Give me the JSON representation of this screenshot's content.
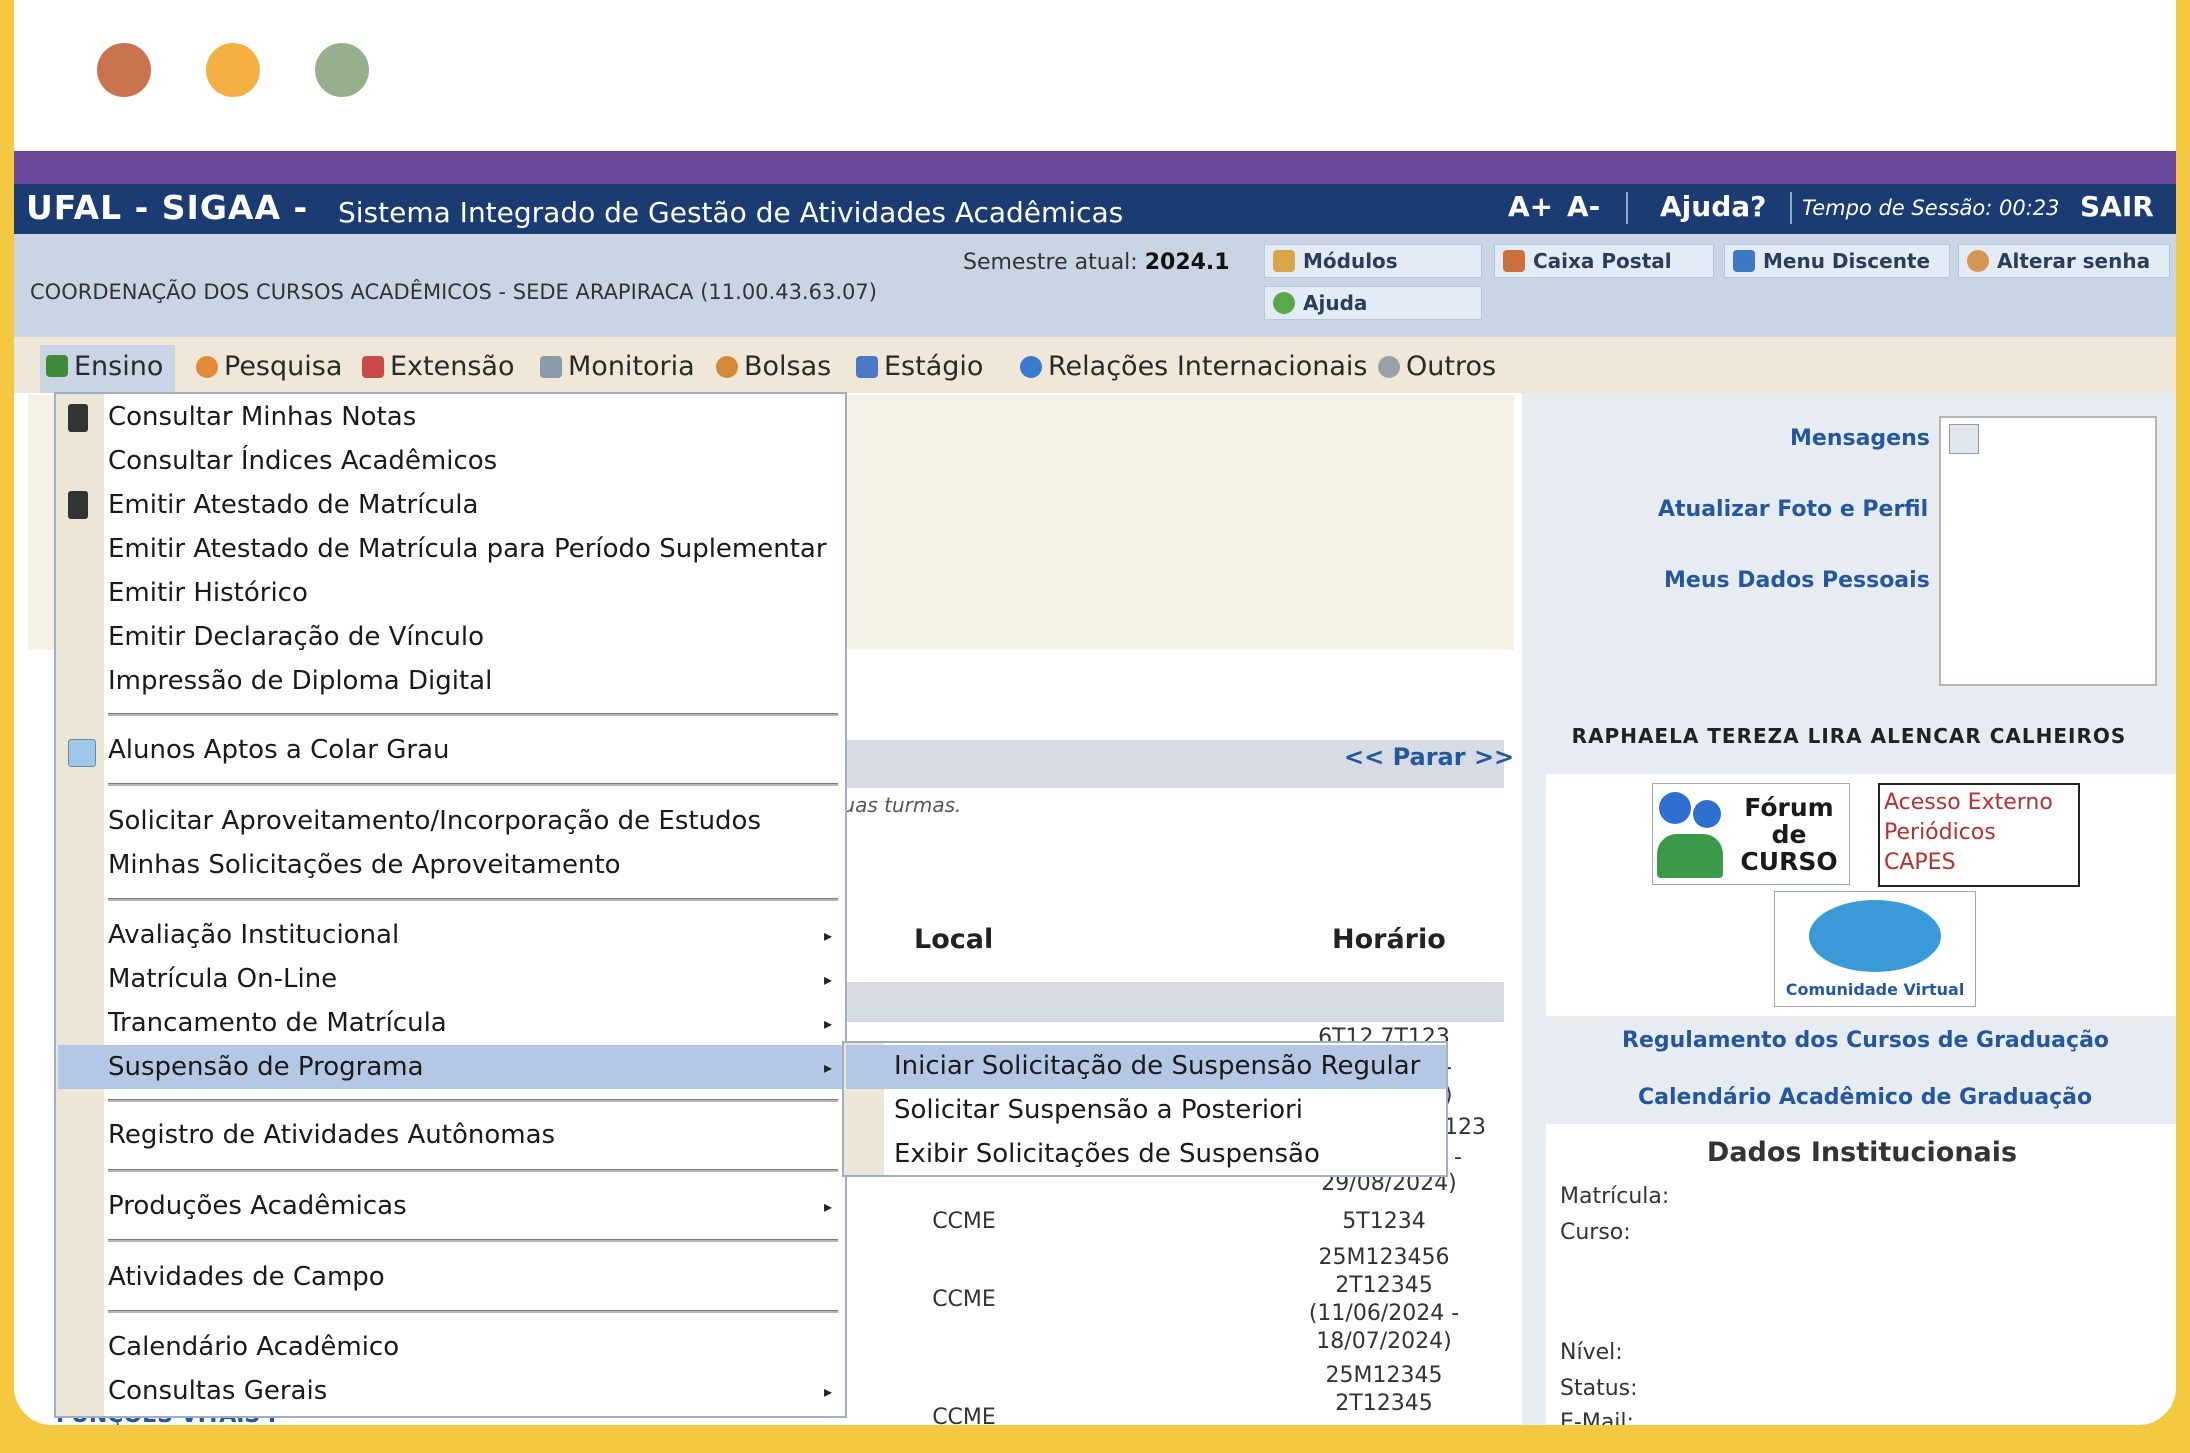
{
  "window": {
    "dots": [
      "#c9744f",
      "#f5b043",
      "#96b08e"
    ]
  },
  "header": {
    "brand": "UFAL - SIGAA -",
    "system": "Sistema Integrado de Gestão de Atividades Acadêmicas",
    "font_up": "A+",
    "font_down": "A-",
    "help": "Ajuda?",
    "session_label": "Tempo de Sessão: 00:23",
    "logout": "SAIR"
  },
  "info": {
    "unit": "COORDENAÇÃO DOS CURSOS ACADÊMICOS - SEDE ARAPIRACA (11.00.43.63.07)",
    "semester_label": "Semestre atual:",
    "semester_value": "2024.1",
    "buttons": {
      "modulos": "Módulos",
      "ajuda": "Ajuda",
      "caixa_postal": "Caixa Postal",
      "menu_discente": "Menu Discente",
      "alterar_senha": "Alterar senha"
    }
  },
  "menubar": {
    "items": [
      "Ensino",
      "Pesquisa",
      "Extensão",
      "Monitoria",
      "Bolsas",
      "Estágio",
      "Relações Internacionais",
      "Outros"
    ]
  },
  "dropdown": {
    "items": [
      "Consultar Minhas Notas",
      "Consultar Índices Acadêmicos",
      "Emitir Atestado de Matrícula",
      "Emitir Atestado de Matrícula para Período Suplementar",
      "Emitir Histórico",
      "Emitir Declaração de Vínculo",
      "Impressão de Diploma Digital",
      "Alunos Aptos a Colar Grau",
      "Solicitar Aproveitamento/Incorporação de Estudos",
      "Minhas Solicitações de Aproveitamento",
      "Avaliação Institucional",
      "Matrícula On-Line",
      "Trancamento de Matrícula",
      "Suspensão de Programa",
      "Registro de Atividades Autônomas",
      "Produções Acadêmicas",
      "Atividades de Campo",
      "Calendário Acadêmico",
      "Consultas Gerais"
    ]
  },
  "submenu": {
    "items": [
      "Iniciar Solicitação de Suspensão Regular",
      "Solicitar Suspensão a Posteriori",
      "Exibir Solicitações de Suspensão"
    ]
  },
  "main": {
    "parar": "<< Parar >>",
    "turmas_text": "suas turmas.",
    "col_local": "Local",
    "col_horario": "Horário",
    "partial_line": "FUNÇÕES VITAIS I",
    "rows": [
      {
        "local": "",
        "horario": "6T12 7T123"
      },
      {
        "local": "",
        "horario": "-"
      },
      {
        "local": "",
        "horario": ")"
      },
      {
        "local": "",
        "horario": "123"
      },
      {
        "local": "",
        "horario": "-"
      },
      {
        "local": "",
        "horario": "29/08/2024)"
      },
      {
        "local": "CCME",
        "horario": "5T1234"
      },
      {
        "local": "CCME",
        "horario": "25M123456"
      },
      {
        "local": "",
        "horario": "2T12345"
      },
      {
        "local": "",
        "horario": "(11/06/2024 -"
      },
      {
        "local": "",
        "horario": "18/07/2024)"
      },
      {
        "local": "",
        "horario": "25M12345"
      },
      {
        "local": "",
        "horario": "2T12345"
      },
      {
        "local": "CCME",
        "horario": ""
      }
    ]
  },
  "sidebar": {
    "mensagens": "Mensagens",
    "atualizar_foto": "Atualizar Foto e Perfil",
    "meus_dados": "Meus Dados Pessoais",
    "user_name": "RAPHAELA TEREZA LIRA ALENCAR CALHEIROS",
    "forum_logo": "Fórum de CURSO",
    "capes_logo": "Acesso Externo Periódicos CAPES",
    "comunidade_logo": "Comunidade Virtual",
    "regulamento": "Regulamento dos Cursos de Graduação",
    "calendario": "Calendário Acadêmico de Graduação",
    "dados_title": "Dados Institucionais",
    "matricula_label": "Matrícula:",
    "curso_label": "Curso:",
    "nivel_label": "Nível:",
    "status_label": "Status:",
    "email_label": "E-Mail:"
  }
}
